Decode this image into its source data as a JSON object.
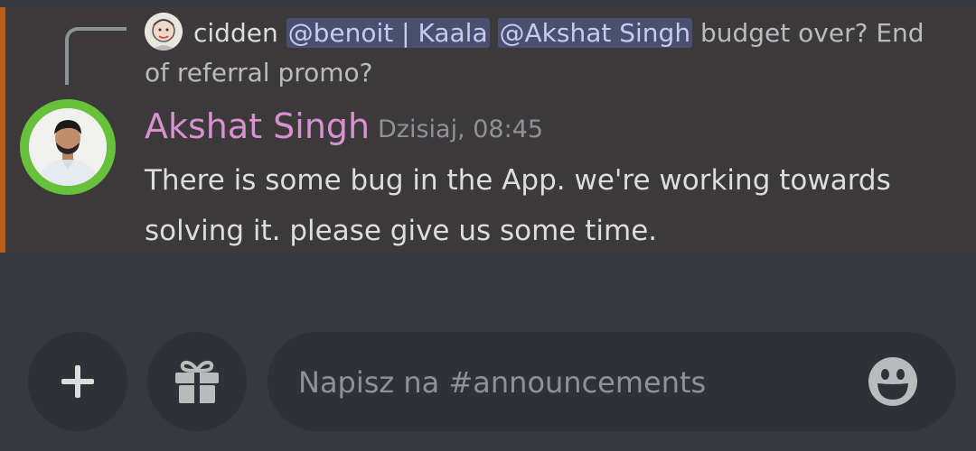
{
  "reply": {
    "author": "cidden",
    "mention1": "@benoit | Kaala",
    "mention2": "@Akshat Singh",
    "text": "budget over? End of referral promo?"
  },
  "message": {
    "author": "Akshat Singh",
    "timestamp": "Dzisiaj, 08:45",
    "line1": "There is some bug in the App. we're working towards",
    "line2": "solving it. please give us some time."
  },
  "composer": {
    "placeholder": "Napisz na #announcements",
    "add_icon": "plus-icon",
    "gift_icon": "gift-icon",
    "emoji_icon": "emoji-icon"
  },
  "colors": {
    "background": "#36393f",
    "message_highlight": "#3b393a",
    "author": "#d990d1",
    "mention_bg": "#4a4f6e",
    "avatar_ring": "#68c13a"
  }
}
